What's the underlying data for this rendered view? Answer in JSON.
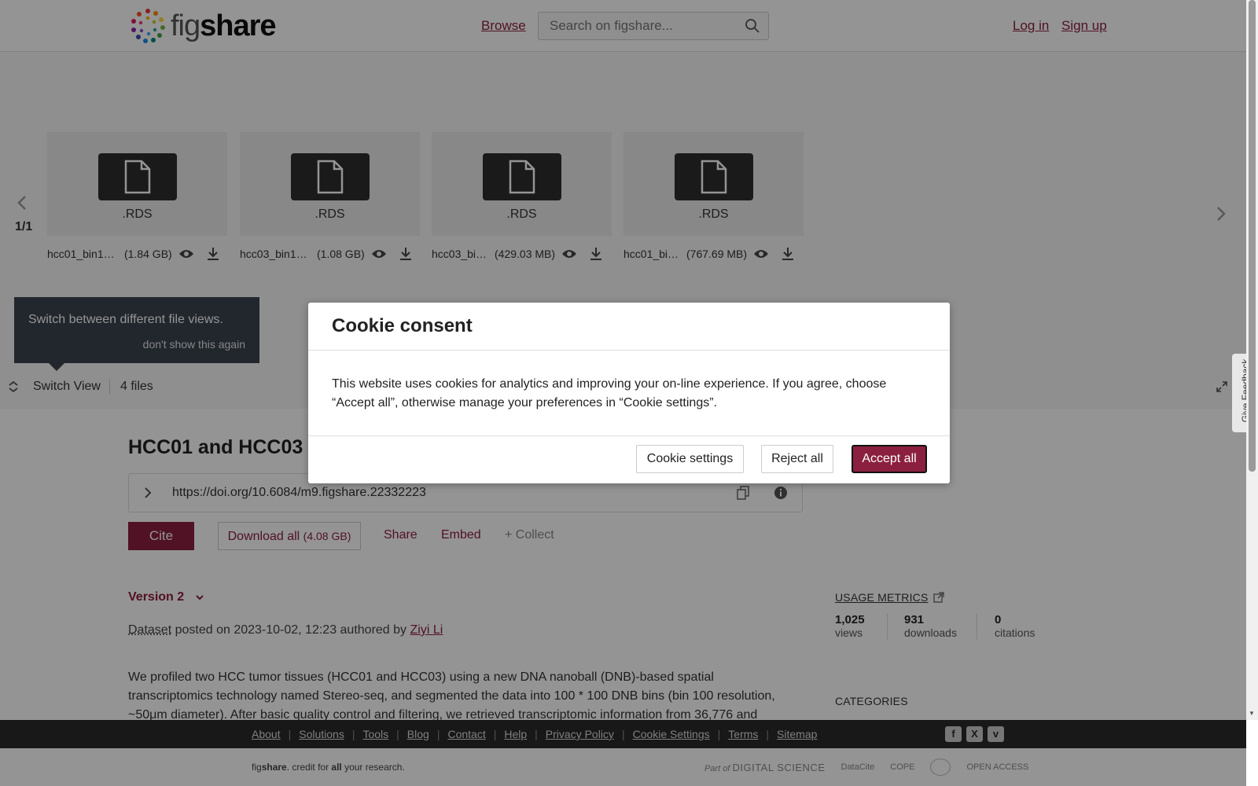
{
  "header": {
    "logo_text_a": "fig",
    "logo_text_b": "share",
    "browse_label": "Browse",
    "search_placeholder": "Search on figshare...",
    "login_label": "Log in",
    "signup_label": "Sign up"
  },
  "carousel": {
    "pager": "1/1",
    "files": [
      {
        "ext": ".RDS",
        "name": "hcc01_bin1…",
        "size": "(1.84 GB)"
      },
      {
        "ext": ".RDS",
        "name": "hcc03_bin1…",
        "size": "(1.08 GB)"
      },
      {
        "ext": ".RDS",
        "name": "hcc03_bi…",
        "size": "(429.03 MB)"
      },
      {
        "ext": ".RDS",
        "name": "hcc01_bi…",
        "size": "(767.69 MB)"
      }
    ]
  },
  "tooltip": {
    "text": "Switch between different file views.",
    "dismiss": "don't show this again"
  },
  "switchbar": {
    "label": "Switch View",
    "file_count": "4 files"
  },
  "item": {
    "title": "HCC01 and HCC03 S",
    "doi": "https://doi.org/10.6084/m9.figshare.22332223",
    "cite_label": "Cite",
    "download_label": "Download all",
    "download_size": "(4.08 GB)",
    "share_label": "Share",
    "embed_label": "Embed",
    "collect_label": "+ Collect",
    "version_label": "Version 2",
    "posted_type": "Dataset",
    "posted_mid": " posted on 2023-10-02, 12:23 authored by ",
    "author": "Ziyi Li",
    "description": " We profiled two HCC tumor tissues (HCC01 and HCC03) using a new DNA nanoball (DNB)-based spatial transcriptomics technology named Stereo-seq, and segmented the data into 100 * 100 DNB bins (bin 100 resolution, ~50μm diameter).  After basic quality control and filtering, we retrieved transcriptomic information from 36,776 and"
  },
  "metrics": {
    "title": "USAGE METRICS",
    "views": {
      "value": "1,025",
      "label": "views"
    },
    "downloads": {
      "value": "931",
      "label": "downloads"
    },
    "citations": {
      "value": "0",
      "label": "citations"
    },
    "categories_title": "CATEGORIES"
  },
  "footer": {
    "links": [
      "About",
      "Solutions",
      "Tools",
      "Blog",
      "Contact",
      "Help",
      "Privacy Policy",
      "Cookie Settings",
      "Terms",
      "Sitemap"
    ],
    "tagline_a": "fig",
    "tagline_b": "share",
    "tagline_c": ". credit for ",
    "tagline_d": "all",
    "tagline_e": " your research.",
    "partner_part_of": "Part of",
    "partner_ds": "DIGITAL SCIENCE",
    "partner_datacite": "DataCite",
    "partner_cope": "COPE",
    "partner_oa": "OPEN ACCESS"
  },
  "feedback_label": "Give Feedback",
  "modal": {
    "title": "Cookie consent",
    "body": "This website uses cookies for analytics and improving your on-line experience. If you agree, choose “Accept all”, otherwise manage your preferences in “Cookie settings”.",
    "settings_label": "Cookie settings",
    "reject_label": "Reject all",
    "accept_label": "Accept all"
  },
  "colors": {
    "brand": "#8b1f3f",
    "overlay": "rgba(0,0,0,0.42)",
    "footer_bg": "#2a2a2a"
  }
}
